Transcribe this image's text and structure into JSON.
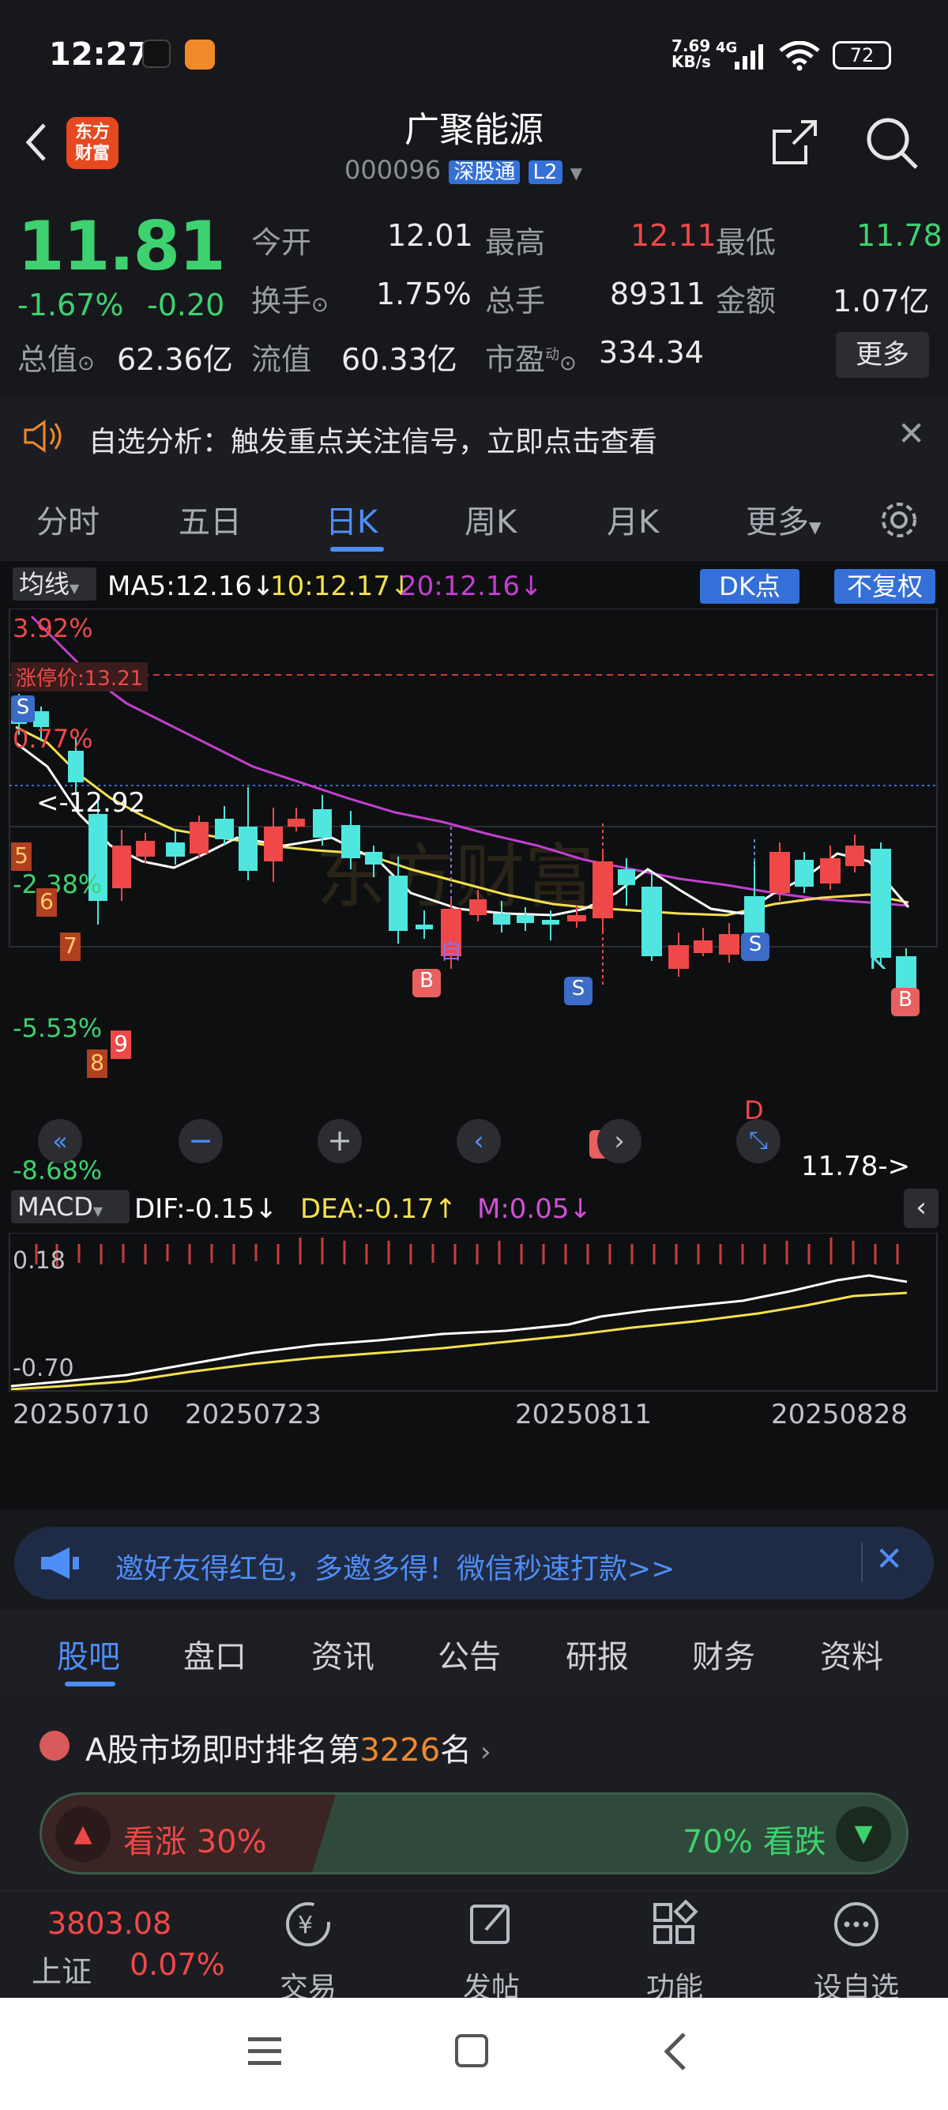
{
  "status_bar": {
    "time": "12:27",
    "network_speed": "7.69\nKB/s",
    "network_type": "4G",
    "battery": "72"
  },
  "header": {
    "logo_text": "东方\n财富",
    "stock_name": "广聚能源",
    "stock_code": "000096",
    "badge_connect": "深股通",
    "badge_level": "L2"
  },
  "quote": {
    "price": "11.81",
    "change_pct": "-1.67%",
    "change_amt": "-0.20",
    "open_label": "今开",
    "open": "12.01",
    "high_label": "最高",
    "high": "12.11",
    "low_label": "最低",
    "low": "11.78",
    "turnover_label": "换手",
    "turnover": "1.75%",
    "volume_label": "总手",
    "volume": "89311",
    "amount_label": "金额",
    "amount": "1.07亿",
    "mktcap_label": "总值",
    "mktcap": "62.36亿",
    "float_label": "流值",
    "float": "60.33亿",
    "pe_label": "市盈",
    "pe_sup": "动",
    "pe": "334.34",
    "more": "更多"
  },
  "notice": {
    "text": "自选分析：触发重点关注信号，立即点击查看"
  },
  "chart_tabs": [
    "分时",
    "五日",
    "日K",
    "周K",
    "月K",
    "更多"
  ],
  "active_chart_tab": "日K",
  "kline": {
    "ma_selector": "均线",
    "ma5": "MA5:12.16",
    "ma10": "10:12.17",
    "ma20": "20:12.16",
    "dk_button": "DK点",
    "adjust_button": "不复权",
    "axis_labels": [
      "3.92%",
      "0.77%",
      "-2.38%",
      "-5.53%",
      "-8.68%"
    ],
    "limit_up_label": "涨停价:13.21",
    "price_marker_high": "12.92",
    "price_marker_low": "11.78",
    "watermark": "东方财富",
    "signal_labels": [
      "5",
      "6",
      "7",
      "8",
      "9"
    ],
    "marker_letters": {
      "sell": "S",
      "buy": "B",
      "self": "自",
      "k": "K",
      "d": "D"
    }
  },
  "macd": {
    "selector": "MACD",
    "dif": "DIF:-0.15",
    "dea": "DEA:-0.17",
    "m": "M:0.05",
    "axis_top": "0.18",
    "axis_bottom": "-0.70"
  },
  "dates": [
    "20250710",
    "20250723",
    "20250811",
    "20250828"
  ],
  "chart_data": [
    {
      "type": "candlestick",
      "title": "",
      "y_axis_labels": [
        "3.92%",
        "0.77%",
        "-2.38%",
        "-5.53%",
        "-8.68%"
      ],
      "x_labels": [
        "20250710",
        "20250723",
        "20250811",
        "20250828"
      ],
      "series": [
        {
          "name": "MA5",
          "last": 12.16
        },
        {
          "name": "10",
          "last": 12.17
        },
        {
          "name": "20",
          "last": 12.16
        }
      ],
      "annotations": [
        "涨停价:13.21",
        "12.92",
        "11.78"
      ]
    },
    {
      "type": "line",
      "title": "",
      "y_axis_labels": [
        "0.18",
        "-0.70"
      ],
      "series": [
        {
          "name": "DIF",
          "last": -0.15
        },
        {
          "name": "DEA",
          "last": -0.17
        },
        {
          "name": "M",
          "last": 0.05
        }
      ]
    }
  ],
  "promo": {
    "text": "邀好友得红包，多邀多得！微信秒速打款>>"
  },
  "bottom_tabs": [
    "股吧",
    "盘口",
    "资讯",
    "公告",
    "研报",
    "财务",
    "资料"
  ],
  "active_bottom_tab": "股吧",
  "ranking": {
    "prefix": "A股市场即时排名第",
    "rank": "3226",
    "suffix": "名",
    "bull_label": "看涨 30%",
    "bear_label": "70% 看跌",
    "bull_pct": 30
  },
  "footer": {
    "index_value": "3803.08",
    "index_name": "上证",
    "index_change": "0.07%",
    "trade": "交易",
    "post": "发帖",
    "function": "功能",
    "watchlist": "设自选"
  },
  "colors": {
    "up": "#f04848",
    "down": "#4ee6df",
    "ma5": "#ffffff",
    "ma10": "#f4e04d",
    "ma20": "#c43fd1",
    "accent": "#4e8ef7"
  }
}
